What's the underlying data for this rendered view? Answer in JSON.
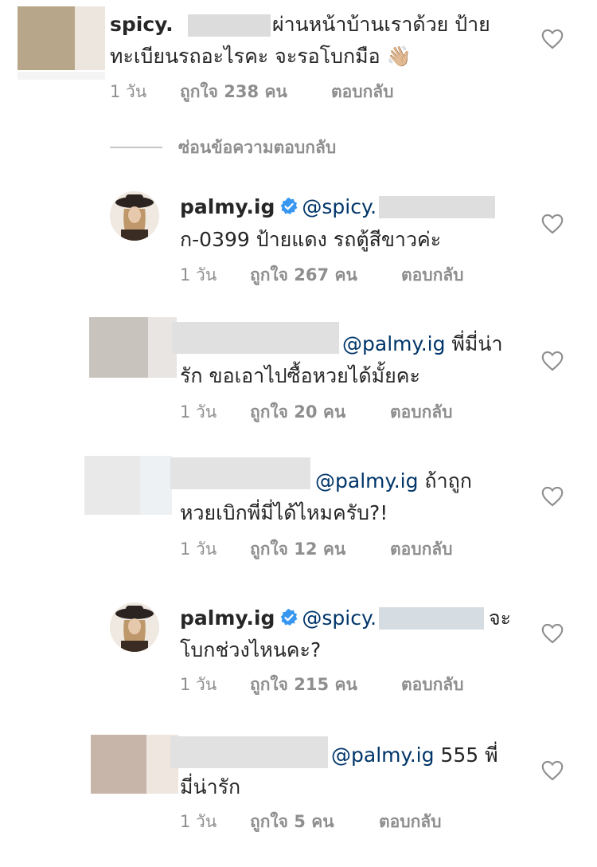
{
  "comments": [
    {
      "username": "spicy.",
      "text_line1": "ผ่านหน้าบ้านเราด้วย ป้าย",
      "text_line2": "ทะเบียนรถอะไรคะ จะรอโบกมือ 👋🏼",
      "time": "1 วัน",
      "likes": "ถูกใจ 238 คน",
      "reply": "ตอบกลับ"
    },
    {
      "username": "palmy.ig",
      "mention": "@spicy.",
      "text_line2": "ก-0399 ป้ายแดง รถตู้สีขาวค่ะ",
      "time": "1 วัน",
      "likes": "ถูกใจ 267 คน",
      "reply": "ตอบกลับ"
    },
    {
      "mention": "@palmy.ig",
      "text_line1": " พี่มี่น่า",
      "text_line2": "รัก ขอเอาไปซื้อหวยได้มั้ยคะ",
      "time": "1 วัน",
      "likes": "ถูกใจ 20 คน",
      "reply": "ตอบกลับ"
    },
    {
      "mention": "@palmy.ig",
      "text_line1": " ถ้าถูก",
      "text_line2": "หวยเบิกพี่มี่ได้ไหมครับ?!",
      "time": "1 วัน",
      "likes": "ถูกใจ 12 คน",
      "reply": "ตอบกลับ"
    },
    {
      "username": "palmy.ig",
      "mention": "@spicy.",
      "text_line1": "จะ",
      "text_line2": "โบกช่วงไหนคะ?",
      "time": "1 วัน",
      "likes": "ถูกใจ 215 คน",
      "reply": "ตอบกลับ"
    },
    {
      "mention": "@palmy.ig",
      "text_line1": " 555 พี่",
      "text_line2": "มี่น่ารัก",
      "time": "1 วัน",
      "likes": "ถูกใจ 5 คน",
      "reply": "ตอบกลับ"
    }
  ],
  "hide_replies": "ซ่อนข้อความตอบกลับ",
  "colors": {
    "text": "#262626",
    "meta": "#8e8e8e",
    "mention": "#003569",
    "verified": "#3897f0"
  }
}
